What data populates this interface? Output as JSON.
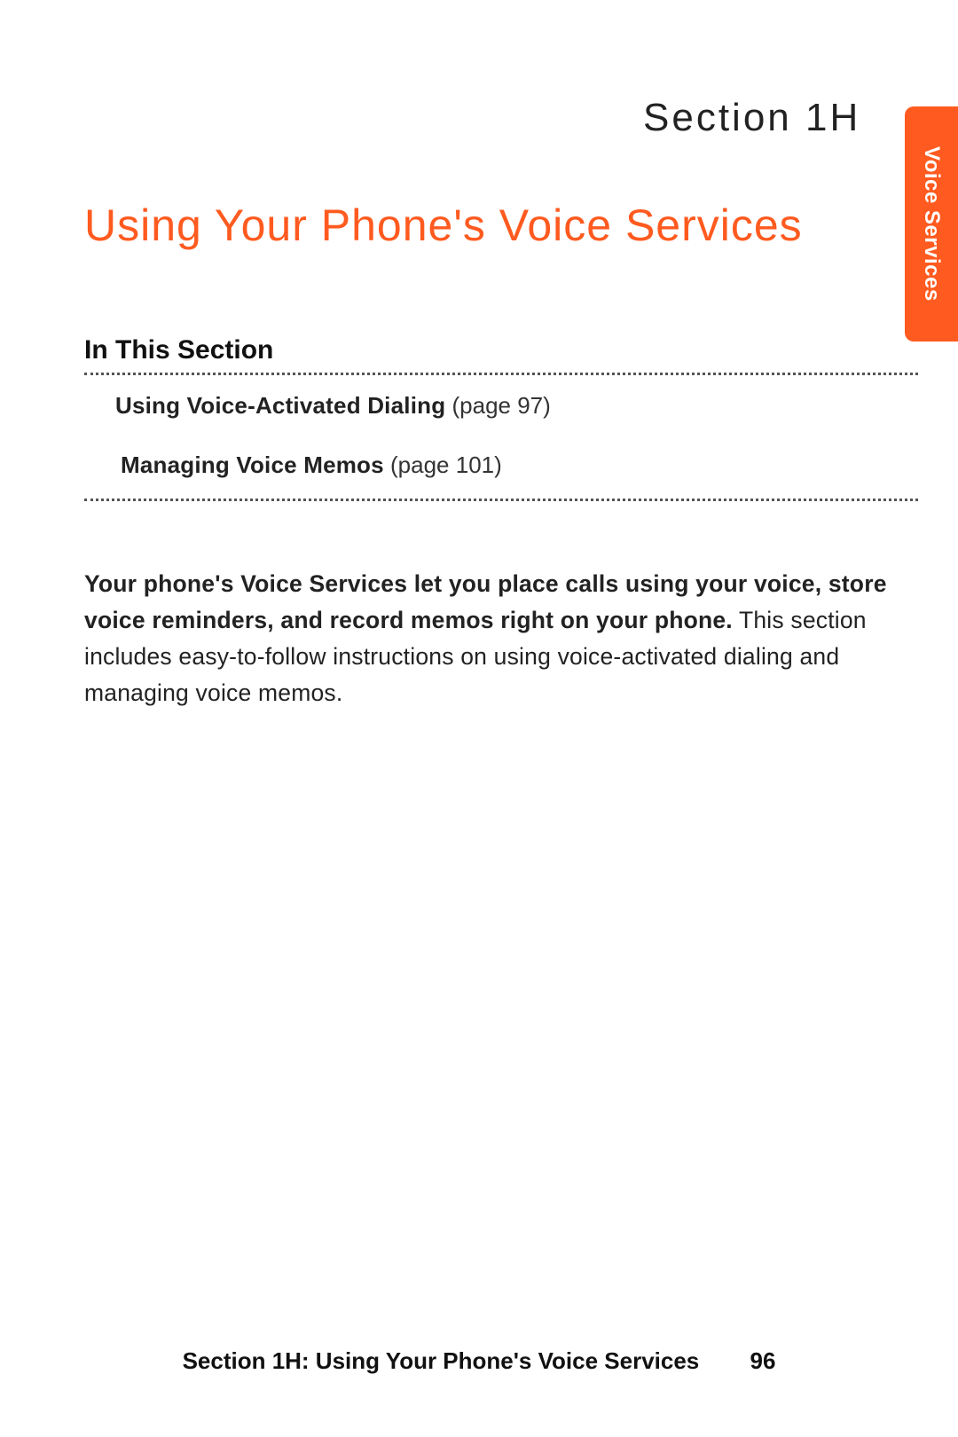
{
  "side_tab": {
    "label": "Voice Services"
  },
  "header": {
    "section_label": "Section 1H",
    "title": "Using Your Phone's Voice Services"
  },
  "in_this_section": {
    "heading": "In This Section",
    "items": [
      {
        "label": "Using Voice-Activated Dialing",
        "ref": " (page 97)"
      },
      {
        "label": "Managing Voice Memos",
        "ref": " (page 101)"
      }
    ]
  },
  "body": {
    "bold": "Your phone's Voice Services let you place calls using your voice, store voice reminders, and record memos right on your phone.",
    "rest": " This section includes easy-to-follow instructions on using voice-activated dialing and managing voice memos."
  },
  "footer": {
    "text": "Section 1H: Using Your Phone's Voice Services",
    "page_number": "96"
  }
}
